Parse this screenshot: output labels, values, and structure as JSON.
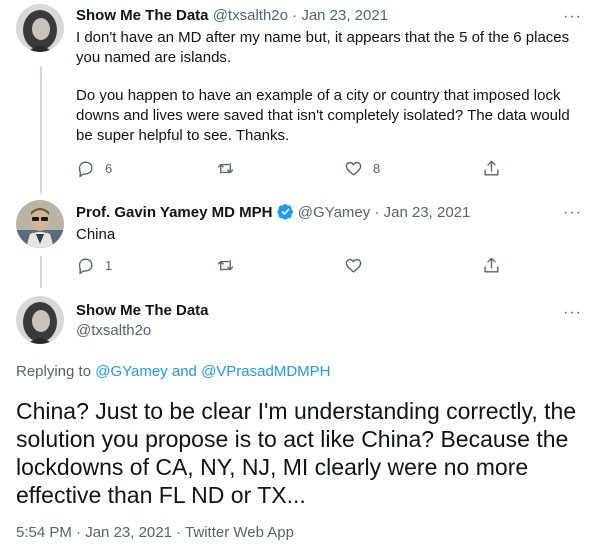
{
  "tweets": [
    {
      "name": "Show Me The Data",
      "handle": "@txsalth2o",
      "separator": "·",
      "date": "Jan 23, 2021",
      "paragraph1": "I don't have an MD after my name but, it appears that the 5 of the 6 places you named are islands.",
      "paragraph2": "Do you happen to have an example of a city or country that imposed lock downs and lives were saved that isn't completely isolated? The data would be super helpful to see. Thanks.",
      "reply_count": "6",
      "retweet_count": "",
      "like_count": "8",
      "more": "···"
    },
    {
      "name": "Prof. Gavin Yamey MD MPH",
      "handle": "@GYamey",
      "separator": "·",
      "date": "Jan 23, 2021",
      "text": "China",
      "reply_count": "1",
      "retweet_count": "",
      "like_count": "",
      "more": "···"
    }
  ],
  "main_tweet": {
    "name": "Show Me The Data",
    "handle": "@txsalth2o",
    "more": "···",
    "replying_prefix": "Replying to",
    "replying_user1": "@GYamey",
    "replying_and": "and",
    "replying_user2": "@VPrasadMDMPH",
    "text": "China? Just to be clear I'm understanding correctly, the solution you propose is to act like China? Because the lockdowns of CA, NY, NJ, MI clearly were no more effective than FL ND or TX...",
    "time": "5:54 PM",
    "separator": "·",
    "date": "Jan 23, 2021",
    "client": "Twitter Web App"
  },
  "colors": {
    "accent": "#1d9bf0",
    "secondary_text": "#536471",
    "thread_line": "#cfd9de"
  },
  "icons": [
    "reply-icon",
    "retweet-icon",
    "like-icon",
    "share-icon",
    "verified-badge-icon",
    "more-icon"
  ]
}
